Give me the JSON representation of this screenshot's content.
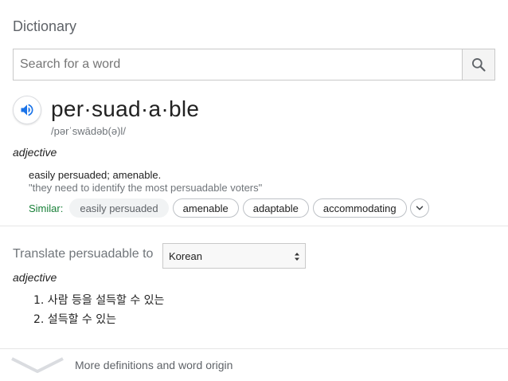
{
  "header": {
    "title": "Dictionary"
  },
  "search": {
    "placeholder": "Search for a word",
    "value": ""
  },
  "entry": {
    "headword": "per·suad·a·ble",
    "phonetic": "/pərˈswādəb(ə)l/",
    "part_of_speech": "adjective",
    "definition": "easily persuaded; amenable.",
    "example": "\"they need to identify the most persuadable voters\"",
    "similar_label": "Similar:",
    "similar": [
      "easily persuaded",
      "amenable",
      "adaptable",
      "accommodating"
    ]
  },
  "translate": {
    "label": "Translate persuadable to",
    "selected_language": "Korean",
    "part_of_speech": "adjective",
    "items": [
      "1. 사람 등을 설득할 수 있는",
      "2. 설득할 수 있는"
    ]
  },
  "footer": {
    "more_label": "More definitions and word origin"
  },
  "colors": {
    "similar_label": "#188038",
    "speaker_icon": "#1a73e8",
    "muted_text": "#70757a"
  },
  "icons": {
    "search": "search-icon",
    "speaker": "speaker-icon",
    "expand": "chevron-down-icon",
    "select": "select-arrows-icon"
  }
}
